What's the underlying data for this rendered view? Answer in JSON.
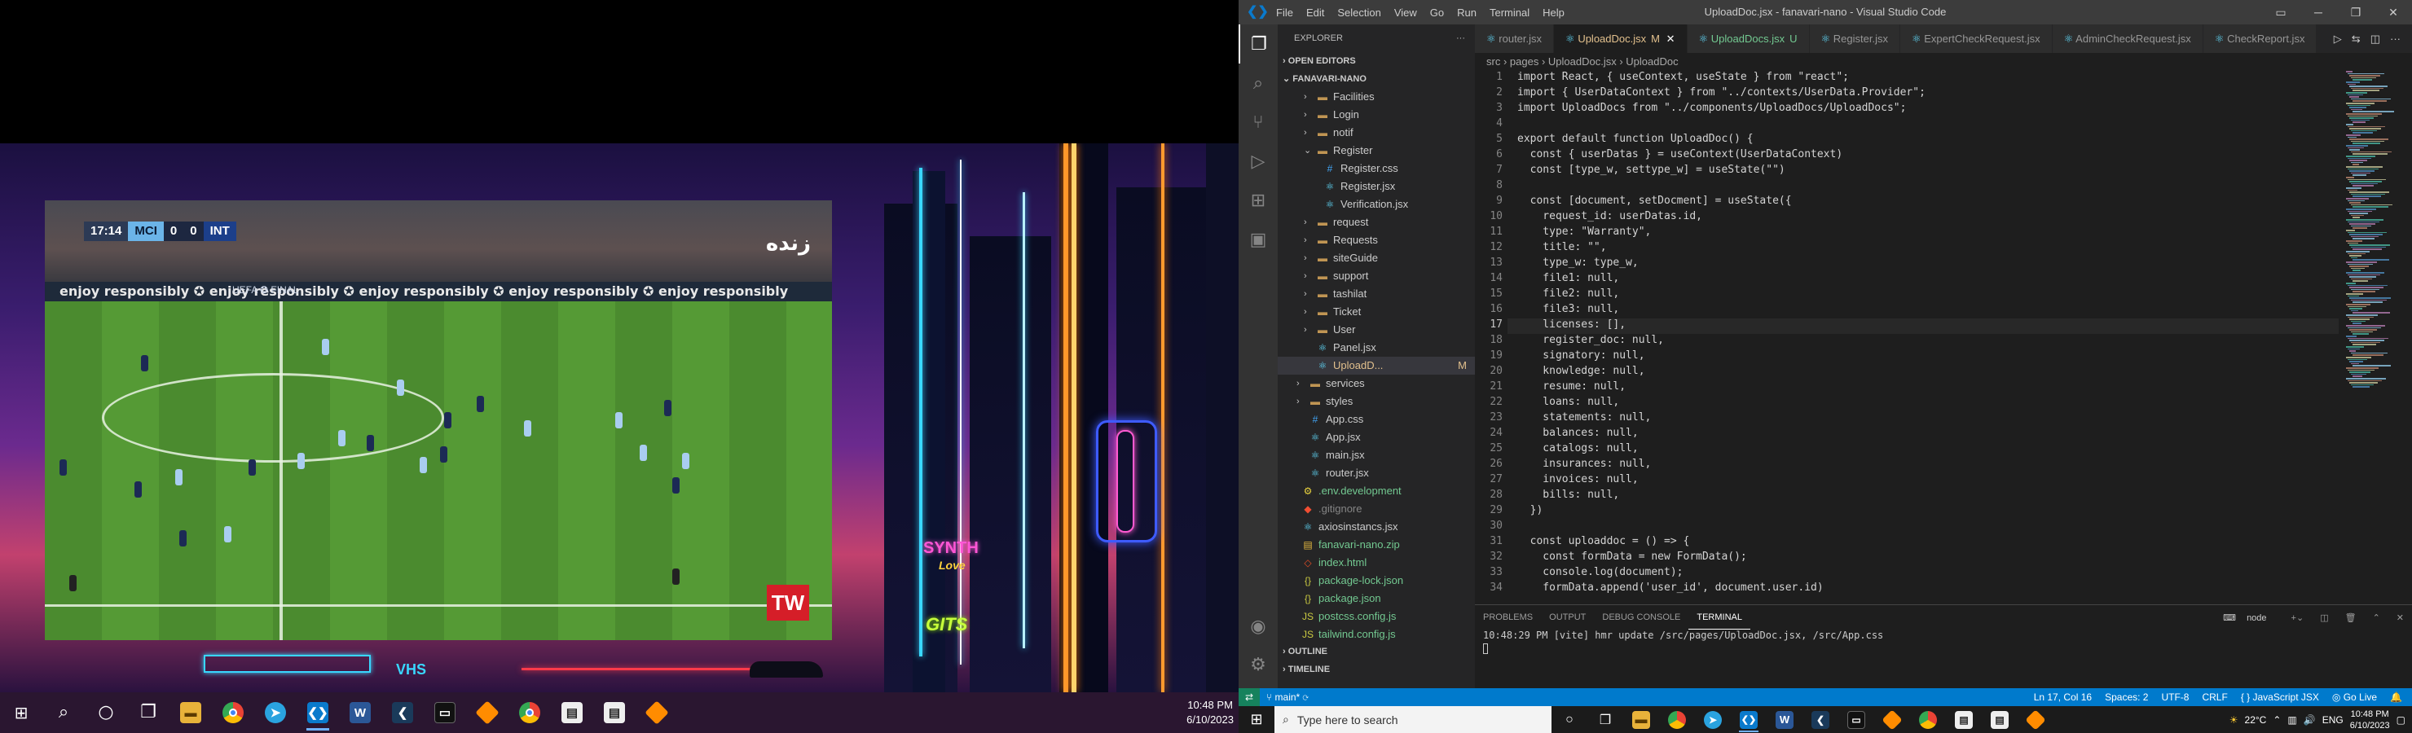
{
  "left_monitor": {
    "stream": {
      "clock": "17:14",
      "home_team": "MCI",
      "home_score": "0",
      "away_score": "0",
      "away_team": "INT",
      "channel_logo": "زنده",
      "ad_text": "enjoy responsibly ✪   enjoy responsibly ✪   enjoy responsibly ✪   enjoy responsibly ✪   enjoy responsibly",
      "ad_text_2": "UEFA ✪ FINAL",
      "badge": "TW"
    },
    "wallpaper": {
      "sign_1": "SYNTH",
      "sign_2": "Love",
      "sign_3": "GITS",
      "sign_4": "VHS"
    },
    "taskbar": {
      "time": "10:48 PM",
      "date": "6/10/2023",
      "icons": [
        "windows-start-icon",
        "search-icon",
        "cortana-icon",
        "task-view-icon",
        "file-explorer-icon",
        "chrome-icon",
        "telegram-icon",
        "vscode-icon",
        "word-icon",
        "terminal-icon",
        "terminal-icon-2",
        "sublime-icon",
        "chrome-icon-2",
        "notepad-icon",
        "notepad-icon-2",
        "sublime-icon-2"
      ]
    }
  },
  "vscode": {
    "title": "UploadDoc.jsx - fanavari-nano - Visual Studio Code",
    "menu": [
      "File",
      "Edit",
      "Selection",
      "View",
      "Go",
      "Run",
      "Terminal",
      "Help"
    ],
    "explorer_label": "EXPLORER",
    "open_editors": "OPEN EDITORS",
    "project": "FANAVARI-NANO",
    "tree": [
      {
        "name": "Facilities",
        "type": "folder",
        "depth": 2,
        "open": false
      },
      {
        "name": "Login",
        "type": "folder",
        "depth": 2,
        "open": false
      },
      {
        "name": "notif",
        "type": "folder",
        "depth": 2,
        "open": false
      },
      {
        "name": "Register",
        "type": "folder",
        "depth": 2,
        "open": true
      },
      {
        "name": "Register.css",
        "type": "css",
        "depth": 3
      },
      {
        "name": "Register.jsx",
        "type": "jsx",
        "depth": 3
      },
      {
        "name": "Verification.jsx",
        "type": "jsx",
        "depth": 3
      },
      {
        "name": "request",
        "type": "folder",
        "depth": 2,
        "open": false
      },
      {
        "name": "Requests",
        "type": "folder",
        "depth": 2,
        "open": false
      },
      {
        "name": "siteGuide",
        "type": "folder",
        "depth": 2,
        "open": false
      },
      {
        "name": "support",
        "type": "folder",
        "depth": 2,
        "open": false
      },
      {
        "name": "tashilat",
        "type": "folder",
        "depth": 2,
        "open": false
      },
      {
        "name": "Ticket",
        "type": "folder",
        "depth": 2,
        "open": false
      },
      {
        "name": "User",
        "type": "folder",
        "depth": 2,
        "open": false
      },
      {
        "name": "Panel.jsx",
        "type": "jsx",
        "depth": 2
      },
      {
        "name": "UploadD...",
        "type": "jsx",
        "depth": 2,
        "badge": "M",
        "selected": true
      },
      {
        "name": "services",
        "type": "folder",
        "depth": 1,
        "open": false
      },
      {
        "name": "styles",
        "type": "folder",
        "depth": 1,
        "open": false
      },
      {
        "name": "App.css",
        "type": "css",
        "depth": 1
      },
      {
        "name": "App.jsx",
        "type": "jsx",
        "depth": 1
      },
      {
        "name": "main.jsx",
        "type": "jsx",
        "depth": 1
      },
      {
        "name": "router.jsx",
        "type": "jsx",
        "depth": 1
      },
      {
        "name": ".env.development",
        "type": "env",
        "depth": 0
      },
      {
        "name": ".gitignore",
        "type": "git",
        "depth": 0
      },
      {
        "name": "axiosinstancs.jsx",
        "type": "jsx",
        "depth": 0
      },
      {
        "name": "fanavari-nano.zip",
        "type": "zip",
        "depth": 0
      },
      {
        "name": "index.html",
        "type": "html",
        "depth": 0
      },
      {
        "name": "package-lock.json",
        "type": "json",
        "depth": 0
      },
      {
        "name": "package.json",
        "type": "json",
        "depth": 0
      },
      {
        "name": "postcss.config.js",
        "type": "js",
        "depth": 0
      },
      {
        "name": "tailwind.config.js",
        "type": "js",
        "depth": 0
      }
    ],
    "outline": "OUTLINE",
    "timeline": "TIMELINE",
    "tabs": [
      {
        "label": "router.jsx",
        "mark": "",
        "active": false
      },
      {
        "label": "UploadDoc.jsx",
        "mark": "M",
        "active": true
      },
      {
        "label": "UploadDocs.jsx",
        "mark": "U",
        "active": false
      },
      {
        "label": "Register.jsx",
        "mark": "",
        "active": false
      },
      {
        "label": "ExpertCheckRequest.jsx",
        "mark": "",
        "active": false
      },
      {
        "label": "AdminCheckRequest.jsx",
        "mark": "",
        "active": false
      },
      {
        "label": "CheckReport.jsx",
        "mark": "",
        "active": false
      }
    ],
    "breadcrumb": [
      "src",
      "pages",
      "UploadDoc.jsx",
      "UploadDoc"
    ],
    "code_lines": [
      "import React, { useContext, useState } from \"react\";",
      "import { UserDataContext } from \"../contexts/UserData.Provider\";",
      "import UploadDocs from \"../components/UploadDocs/UploadDocs\";",
      "",
      "export default function UploadDoc() {",
      "  const { userDatas } = useContext(UserDataContext)",
      "  const [type_w, settype_w] = useState(\"\")",
      "",
      "  const [document, setDocment] = useState({",
      "    request_id: userDatas.id,",
      "    type: \"Warranty\",",
      "    title: \"\",",
      "    type_w: type_w,",
      "    file1: null,",
      "    file2: null,",
      "    file3: null,",
      "    licenses: [],",
      "    register_doc: null,",
      "    signatory: null,",
      "    knowledge: null,",
      "    resume: null,",
      "    loans: null,",
      "    statements: null,",
      "    balances: null,",
      "    catalogs: null,",
      "    insurances: null,",
      "    invoices: null,",
      "    bills: null,",
      "  })",
      "",
      "  const uploaddoc = () => {",
      "    const formData = new FormData();",
      "    console.log(document);",
      "    formData.append('user_id', document.user.id)"
    ],
    "current_line": 17,
    "panel_tabs": [
      "PROBLEMS",
      "OUTPUT",
      "DEBUG CONSOLE",
      "TERMINAL"
    ],
    "active_panel_tab": "TERMINAL",
    "terminal_label": "node",
    "terminal_line": "10:48:29 PM [vite] hmr update /src/pages/UploadDoc.jsx, /src/App.css",
    "status": {
      "branch": "main*",
      "position": "Ln 17, Col 16",
      "spaces": "Spaces: 2",
      "encoding": "UTF-8",
      "eol": "CRLF",
      "language": "JavaScript JSX",
      "golive": "Go Live"
    },
    "taskbar": {
      "search_placeholder": "Type here to search",
      "temperature": "22°C",
      "lang": "ENG",
      "time": "10:48 PM",
      "date": "6/10/2023"
    }
  }
}
